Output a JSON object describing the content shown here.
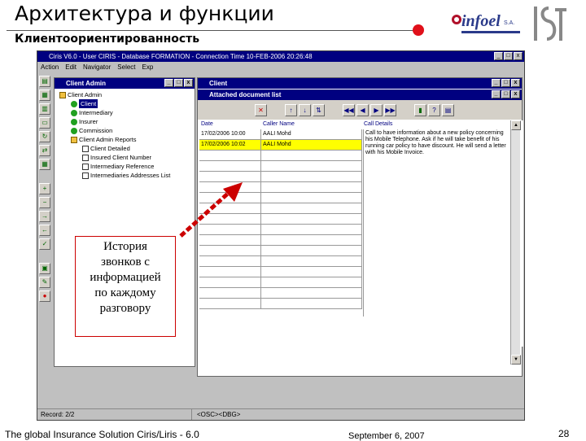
{
  "slide": {
    "title": "Архитектура и функции",
    "subtitle": "Клиентоориентированность",
    "logo_infoel": "infoel",
    "logo_infoel_suffix": "S.A.",
    "logo_ist": "IST",
    "accent_color": "#e0101a"
  },
  "app": {
    "title": "Ciris V6.0 - User CIRIS - Database FORMATION - Connection Time 10-FEB-2006 20:26:48",
    "menu": [
      "Action",
      "Edit",
      "Navigator",
      "Select",
      "Exp"
    ],
    "client_admin": {
      "title": "Client Admin",
      "tree": [
        {
          "label": "Client Admin",
          "icon": "folder-icon"
        },
        {
          "label": "Client",
          "icon": "green-circle-icon",
          "selected": true
        },
        {
          "label": "Intermediary",
          "icon": "green-circle-icon"
        },
        {
          "label": "Insurer",
          "icon": "green-circle-icon"
        },
        {
          "label": "Commission",
          "icon": "green-circle-icon"
        },
        {
          "label": "Client Admin Reports",
          "icon": "folder-icon"
        },
        {
          "label": "Client Detailed",
          "icon": "document-icon"
        },
        {
          "label": "Insured Client Number",
          "icon": "document-icon"
        },
        {
          "label": "Intermediary Reference",
          "icon": "document-icon"
        },
        {
          "label": "Intermediaries Addresses List",
          "icon": "document-icon"
        }
      ]
    },
    "client": {
      "title": "Client",
      "attached_title": "Attached document list",
      "grid": {
        "headers": {
          "date": "Date",
          "caller": "Caller Name",
          "details": "Call Details"
        },
        "rows": [
          {
            "date": "17/02/2006 10:00",
            "caller": "AALI Mohd",
            "selected": false
          },
          {
            "date": "17/02/2006 10:02",
            "caller": "AALI Mohd",
            "selected": true
          }
        ],
        "empty_rows": 15,
        "call_details": "Call to have information about a new policy concerning his Mobile Telephone. Ask if he will take benefit of his running car policy to have discount. He will send a letter with his Mobile Invoice."
      }
    },
    "status": {
      "record": "Record: 2/2",
      "mode": "<OSC><DBG>"
    }
  },
  "callout": {
    "lines": [
      "История",
      "звонков с",
      "информацией",
      "по каждому",
      "разговору"
    ],
    "border_color": "#cc0000"
  },
  "footer": {
    "left": "The global Insurance Solution Ciris/Liris - 6.0",
    "center": "September 6, 2007",
    "page": "28"
  }
}
